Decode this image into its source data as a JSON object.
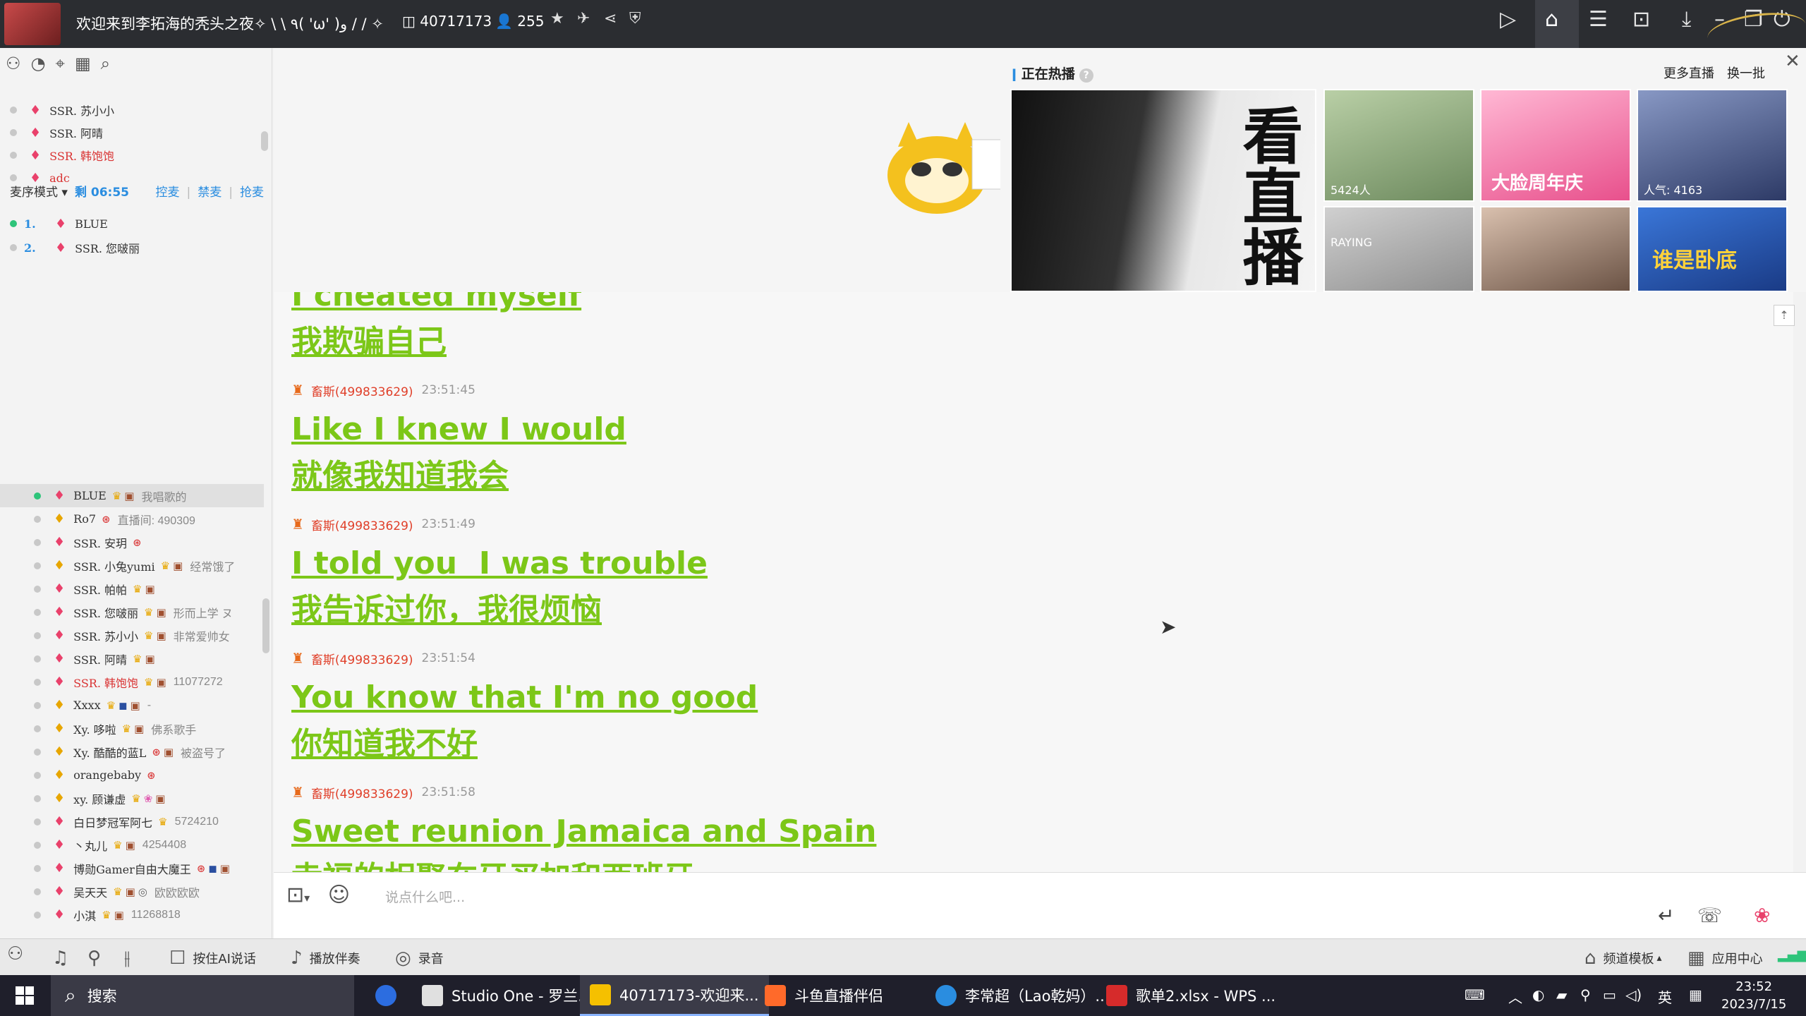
{
  "titlebar": {
    "room_title": "欢迎来到李拓海的秃头之夜✧ \\ \\ ٩( 'ω' )و / / ✧",
    "room_id": "40717173",
    "online_count": "255"
  },
  "left_panel": {
    "queue": [
      {
        "name": "SSR. 苏小小"
      },
      {
        "name": "SSR. 阿晴"
      },
      {
        "name": "SSR. 韩饱饱",
        "highlight": true
      },
      {
        "name": "adc",
        "highlight": true
      }
    ],
    "mode": {
      "label": "麦序模式",
      "timer": "剩 06:55",
      "actions": [
        "控麦",
        "禁麦",
        "抢麦"
      ]
    },
    "mic_queue": [
      {
        "num": "1.",
        "name": "BLUE",
        "active": true
      },
      {
        "num": "2.",
        "name": "SSR. 您啵丽"
      }
    ],
    "users": [
      {
        "name": "BLUE",
        "info": "我唱歌的",
        "online": true
      },
      {
        "name": "Ro7",
        "info": "直播间: 490309"
      },
      {
        "name": "SSR. 安玥",
        "info": ""
      },
      {
        "name": "SSR. 小兔yumi",
        "info": "经常饿了"
      },
      {
        "name": "SSR. 帕帕",
        "info": ""
      },
      {
        "name": "SSR. 您啵丽",
        "info": "形而上学 ヌ"
      },
      {
        "name": "SSR. 苏小小",
        "info": "非常爱帅女"
      },
      {
        "name": "SSR. 阿晴",
        "info": ""
      },
      {
        "name": "SSR. 韩饱饱",
        "info": "11077272",
        "red": true
      },
      {
        "name": "Xxxx",
        "info": "-"
      },
      {
        "name": "Xy. 哆啦",
        "info": "佛系歌手"
      },
      {
        "name": "Xy. 酷酷的蓝L",
        "info": "被盗号了"
      },
      {
        "name": "orangebaby",
        "info": ""
      },
      {
        "name": "xy. 顾谦虚",
        "info": ""
      },
      {
        "name": "白日梦冠军阿七",
        "info": "5724210"
      },
      {
        "name": "丶丸儿",
        "info": "4254408"
      },
      {
        "name": "博勋Gamer自由大魔王",
        "info": ""
      },
      {
        "name": "吴天天",
        "info": "欧欧欧欧"
      },
      {
        "name": "小淇",
        "info": "11268818"
      }
    ]
  },
  "hot": {
    "title": "正在热播",
    "more": "更多直播",
    "refresh": "换一批",
    "big_thumb_text": "看直播",
    "thumbs": [
      {
        "label": "5424人",
        "color": "#8aa37a"
      },
      {
        "label": "大脸周年庆",
        "color": "#f07aa8"
      },
      {
        "label": "人气: 4163",
        "color": "#4a5b86"
      },
      {
        "label": "RAYING",
        "color": "#b9b9b9"
      },
      {
        "label": "",
        "color": "#9c7e6a"
      },
      {
        "label": "谁是卧底",
        "color": "#2a5bb7"
      }
    ]
  },
  "chat": {
    "messages": [
      {
        "type": "lyric",
        "text": "I cheated myself"
      },
      {
        "type": "lyric",
        "text": "我欺骗自己"
      },
      {
        "type": "meta",
        "user": "畜斯(499833629)",
        "time": "23:51:45"
      },
      {
        "type": "lyric",
        "text": "Like I knew I would"
      },
      {
        "type": "lyric",
        "text": "就像我知道我会"
      },
      {
        "type": "meta",
        "user": "畜斯(499833629)",
        "time": "23:51:49"
      },
      {
        "type": "lyric",
        "text": "I told you  I was trouble"
      },
      {
        "type": "lyric",
        "text": "我告诉过你，我很烦恼"
      },
      {
        "type": "meta",
        "user": "畜斯(499833629)",
        "time": "23:51:54"
      },
      {
        "type": "lyric",
        "text": "You know that I'm no good"
      },
      {
        "type": "lyric",
        "text": "你知道我不好"
      },
      {
        "type": "meta",
        "user": "畜斯(499833629)",
        "time": "23:51:58"
      },
      {
        "type": "lyric",
        "text": "Sweet reunion Jamaica and Spain"
      },
      {
        "type": "lyric",
        "text": "幸福的相聚在牙买加和西班牙"
      }
    ],
    "input_placeholder": "说点什么吧..."
  },
  "bottom_bar": {
    "ai_talk": "按住AI说话",
    "play_music": "播放伴奏",
    "record": "录音",
    "channel_template": "频道模板",
    "app_center": "应用中心"
  },
  "taskbar": {
    "search": "搜索",
    "apps": [
      {
        "label": "Studio One - 罗兰...",
        "color": "#e0e0e0"
      },
      {
        "label": "40717173-欢迎来...",
        "color": "#f5c000",
        "active": true
      },
      {
        "label": "斗鱼直播伴侣",
        "color": "#ff6a2a"
      },
      {
        "label": "李常超（Lao乾妈）...",
        "color": "#2a8de0"
      },
      {
        "label": "歌单2.xlsx - WPS ...",
        "color": "#d62b2b"
      }
    ],
    "ime": "英",
    "time": "23:52",
    "date": "2023/7/15"
  },
  "colors": {
    "lyric_green": "#7cc718",
    "username_red": "#e0402a",
    "accent_blue": "#2a8de0"
  }
}
